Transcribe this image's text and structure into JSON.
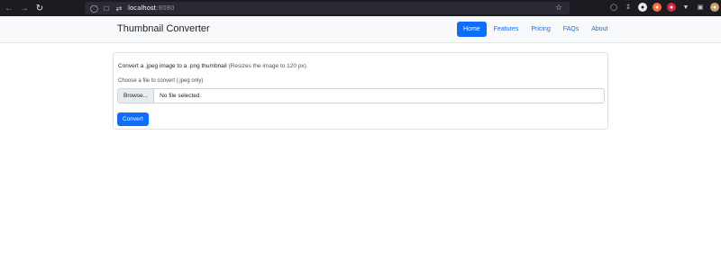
{
  "browser": {
    "url_host": "localhost",
    "url_port": ":8080"
  },
  "navbar": {
    "brand": "Thumbnail Converter",
    "links": [
      "Home",
      "Features",
      "Pricing",
      "FAQs",
      "About"
    ],
    "active": "Home"
  },
  "card": {
    "intro_main": "Convert a .jpeg image to a .png thumbnail",
    "intro_small": "(Resizes the image to 120 px).",
    "file_label": "Choose a file to convert (.jpeg only)",
    "browse_label": "Browse...",
    "file_status": "No file selected.",
    "convert_label": "Convert"
  },
  "colors": {
    "primary": "#0d6efd",
    "chrome_bg": "#1c1b22",
    "navbar_bg": "#f8f9fa"
  }
}
